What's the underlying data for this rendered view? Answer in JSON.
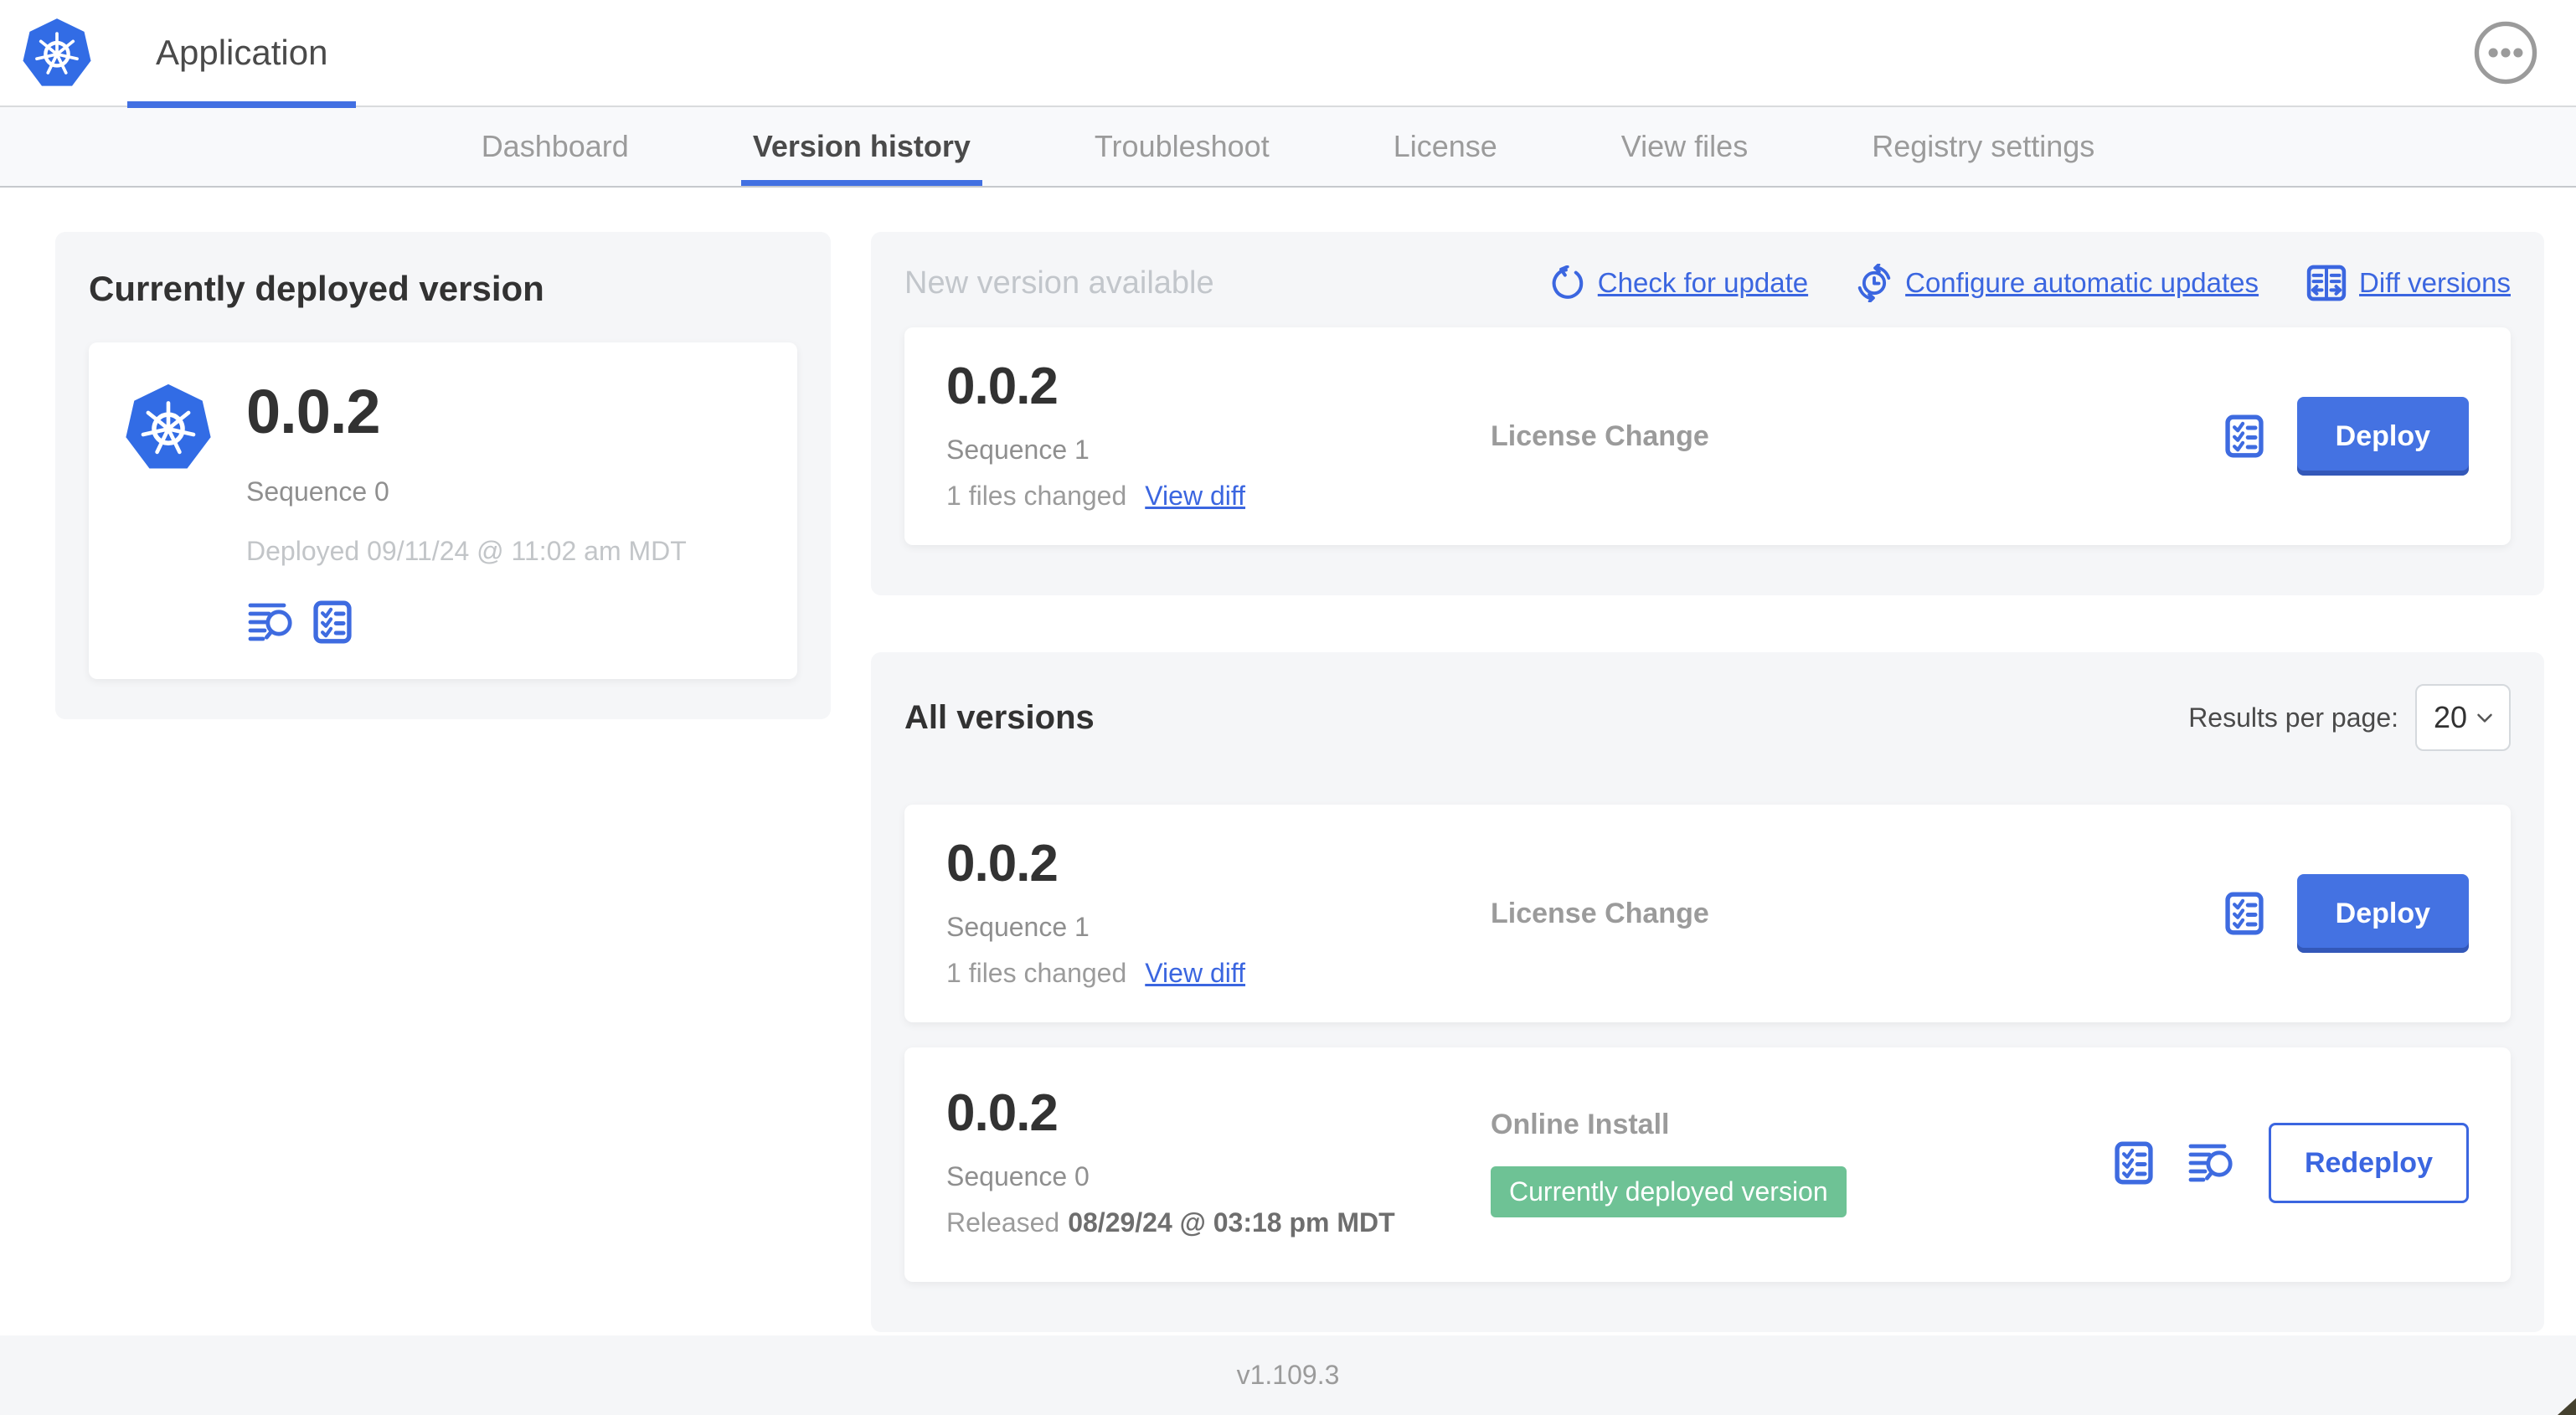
{
  "colors": {
    "primary_blue": "#3B66E0",
    "button_blue": "#4472E2",
    "kubernetes_blue": "#326CE5",
    "badge_green": "#6EC295",
    "panel_gray": "#F5F6F8"
  },
  "header": {
    "app_title": "Application"
  },
  "nav": {
    "active_tab": "Version history",
    "tabs": [
      {
        "label": "Dashboard"
      },
      {
        "label": "Version history"
      },
      {
        "label": "Troubleshoot"
      },
      {
        "label": "License"
      },
      {
        "label": "View files"
      },
      {
        "label": "Registry settings"
      }
    ]
  },
  "deployed_panel": {
    "title": "Currently deployed version",
    "version": "0.0.2",
    "sequence": "Sequence 0",
    "deployed_at": "Deployed 09/11/24 @ 11:02 am MDT"
  },
  "new_version": {
    "title": "New version available",
    "check_for_update": "Check for update",
    "configure_auto_updates": "Configure automatic updates",
    "diff_versions": "Diff versions",
    "card": {
      "version": "0.0.2",
      "sequence": "Sequence 1",
      "files_changed": "1 files changed",
      "view_diff": "View diff",
      "source": "License Change",
      "action": "Deploy"
    }
  },
  "all_versions": {
    "title": "All versions",
    "results_per_page_label": "Results per page:",
    "results_per_page_value": "20",
    "rows": [
      {
        "version": "0.0.2",
        "sequence": "Sequence 1",
        "files_changed": "1 files changed",
        "view_diff": "View diff",
        "source": "License Change",
        "action": "Deploy"
      },
      {
        "version": "0.0.2",
        "sequence": "Sequence 0",
        "released_prefix": "Released",
        "released_date": "08/29/24 @ 03:18 pm MDT",
        "source": "Online Install",
        "badge": "Currently deployed version",
        "action": "Redeploy"
      }
    ]
  },
  "footer": {
    "app_version": "v1.109.3"
  }
}
